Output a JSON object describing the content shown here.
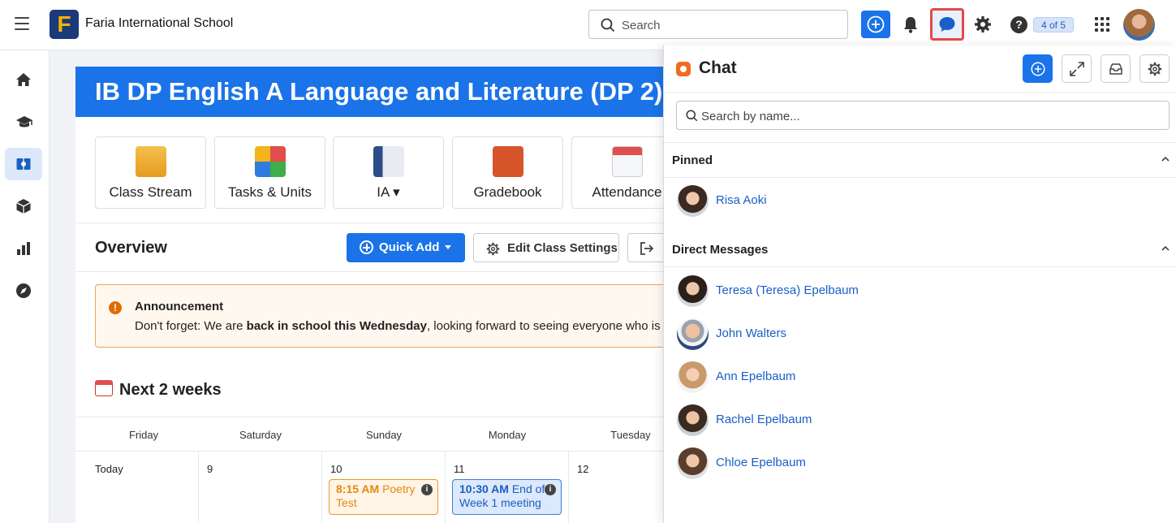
{
  "topbar": {
    "school_name": "Faria International School",
    "logo_letter": "F",
    "search_placeholder": "Search",
    "help_label": "?",
    "progress_badge": "4 of 5"
  },
  "main": {
    "course_title": "IB DP English A Language and Literature (DP 2)",
    "tiles": [
      {
        "label": "Class Stream"
      },
      {
        "label": "Tasks & Units"
      },
      {
        "label": "IA ▾"
      },
      {
        "label": "Gradebook"
      },
      {
        "label": "Attendance"
      }
    ],
    "overview_title": "Overview",
    "quick_add_label": "Quick Add",
    "edit_settings_label": "Edit Class Settings",
    "announcement": {
      "title": "Announcement",
      "text_start": "Don't forget: We are ",
      "text_bold": "back in school this Wednesday",
      "text_end": ", looking forward to seeing everyone who is ab"
    },
    "next_title": "Next 2 weeks",
    "calendar": {
      "days": [
        "Friday",
        "Saturday",
        "Sunday",
        "Monday",
        "Tuesday"
      ],
      "cells": [
        "Today",
        "9",
        "10",
        "11",
        "12"
      ],
      "events": [
        {
          "time": "8:15 AM",
          "title": "Poetry Test"
        },
        {
          "time": "10:30 AM",
          "title": "End of Week 1 meeting"
        }
      ]
    }
  },
  "chat": {
    "title": "Chat",
    "search_placeholder": "Search by name...",
    "pinned_label": "Pinned",
    "pinned": [
      {
        "name": "Risa Aoki"
      }
    ],
    "dm_label": "Direct Messages",
    "direct_messages": [
      {
        "name": "Teresa (Teresa) Epelbaum"
      },
      {
        "name": "John Walters"
      },
      {
        "name": "Ann Epelbaum"
      },
      {
        "name": "Rachel Epelbaum"
      },
      {
        "name": "Chloe Epelbaum"
      }
    ]
  },
  "colors": {
    "accent": "#1a73e8",
    "chat_highlight_border": "#e54848",
    "announcement_border": "#e8a659",
    "event_orange": "#e08a12",
    "event_blue": "#1a5fc4"
  }
}
